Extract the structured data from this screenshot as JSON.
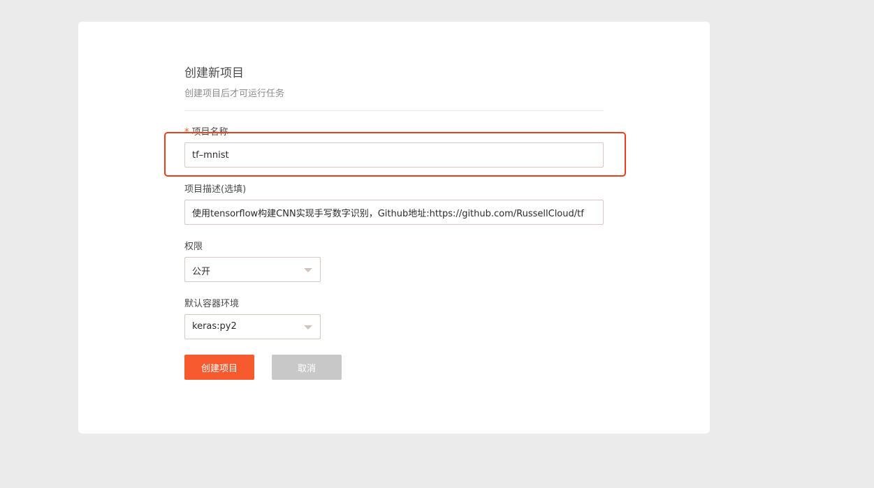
{
  "form": {
    "title": "创建新项目",
    "subtitle": "创建项目后才可运行任务",
    "name_field": {
      "required_mark": "*",
      "label": "项目名称",
      "value": "tf–mnist"
    },
    "description_field": {
      "label": "项目描述(选填)",
      "value": "使用tensorflow构建CNN实现手写数字识别，Github地址:https://github.com/RussellCloud/tf"
    },
    "permission_field": {
      "label": "权限",
      "selected": "公开"
    },
    "environment_field": {
      "label": "默认容器环境",
      "selected": "keras:py2"
    },
    "submit_label": "创建项目",
    "cancel_label": "取消"
  },
  "colors": {
    "background": "#ebebeb",
    "card": "#ffffff",
    "primary": "#f75a2e",
    "cancel": "#c8c8c8",
    "highlight": "#ea3e1b",
    "required": "#f05a28"
  }
}
